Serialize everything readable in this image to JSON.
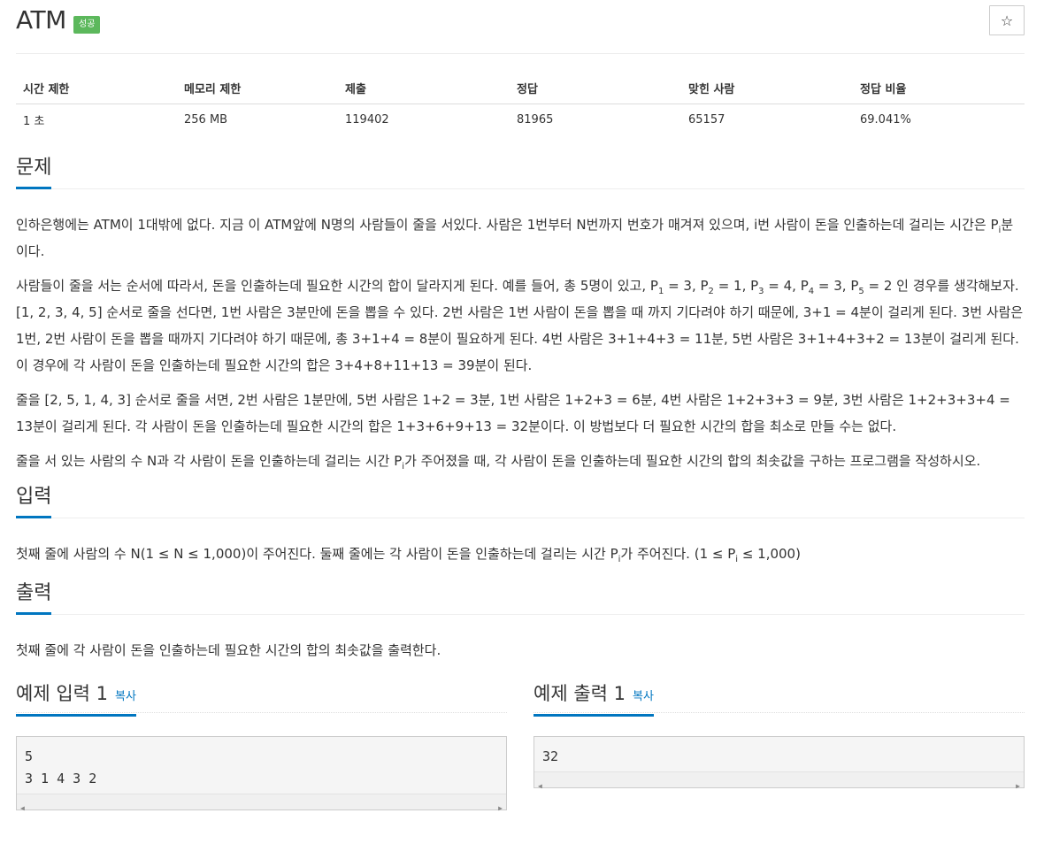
{
  "problem": {
    "title": "ATM",
    "badge": "성공",
    "star": "☆"
  },
  "info": {
    "headers": [
      "시간 제한",
      "메모리 제한",
      "제출",
      "정답",
      "맞힌 사람",
      "정답 비율"
    ],
    "values": [
      "1 초",
      "256 MB",
      "119402",
      "81965",
      "65157",
      "69.041%"
    ]
  },
  "sections": {
    "problem": "문제",
    "input": "입력",
    "output": "출력"
  },
  "text": {
    "p1a": "인하은행에는 ATM이 1대밖에 없다. 지금 이 ATM앞에 N명의 사람들이 줄을 서있다. 사람은 1번부터 N번까지 번호가 매겨져 있으며, i번 사람이 돈을 인출하는데 걸리는 시간은 P",
    "p1sub": "i",
    "p1b": "분이다.",
    "p2a": "사람들이 줄을 서는 순서에 따라서, 돈을 인출하는데 필요한 시간의 합이 달라지게 된다. 예를 들어, 총 5명이 있고, P",
    "p2s1": "1",
    "p2t1": " = 3, P",
    "p2s2": "2",
    "p2t2": " = 1, P",
    "p2s3": "3",
    "p2t3": " = 4, P",
    "p2s4": "4",
    "p2t4": " = 3, P",
    "p2s5": "5",
    "p2b": " = 2 인 경우를 생각해보자. [1, 2, 3, 4, 5] 순서로 줄을 선다면, 1번 사람은 3분만에 돈을 뽑을 수 있다. 2번 사람은 1번 사람이 돈을 뽑을 때 까지 기다려야 하기 때문에, 3+1 = 4분이 걸리게 된다. 3번 사람은 1번, 2번 사람이 돈을 뽑을 때까지 기다려야 하기 때문에, 총 3+1+4 = 8분이 필요하게 된다. 4번 사람은 3+1+4+3 = 11분, 5번 사람은 3+1+4+3+2 = 13분이 걸리게 된다. 이 경우에 각 사람이 돈을 인출하는데 필요한 시간의 합은 3+4+8+11+13 = 39분이 된다.",
    "p3": "줄을 [2, 5, 1, 4, 3] 순서로 줄을 서면, 2번 사람은 1분만에, 5번 사람은 1+2 = 3분, 1번 사람은 1+2+3 = 6분, 4번 사람은 1+2+3+3 = 9분, 3번 사람은 1+2+3+3+4 = 13분이 걸리게 된다. 각 사람이 돈을 인출하는데 필요한 시간의 합은 1+3+6+9+13 = 32분이다. 이 방법보다 더 필요한 시간의 합을 최소로 만들 수는 없다.",
    "p4a": "줄을 서 있는 사람의 수 N과 각 사람이 돈을 인출하는데 걸리는 시간 P",
    "p4sub": "i",
    "p4b": "가 주어졌을 때, 각 사람이 돈을 인출하는데 필요한 시간의 합의 최솟값을 구하는 프로그램을 작성하시오.",
    "in_a": "첫째 줄에 사람의 수 N(1 ≤ N ≤ 1,000)이 주어진다. 둘째 줄에는 각 사람이 돈을 인출하는데 걸리는 시간 P",
    "in_sub1": "i",
    "in_b": "가 주어진다. (1 ≤ P",
    "in_sub2": "i",
    "in_c": " ≤ 1,000)",
    "out": "첫째 줄에 각 사람이 돈을 인출하는데 필요한 시간의 합의 최솟값을 출력한다."
  },
  "samples": {
    "input_title": "예제 입력 1",
    "output_title": "예제 출력 1",
    "copy": "복사",
    "input_lines": [
      "5",
      "3 1 4 3 2"
    ],
    "output_lines": [
      "32"
    ]
  },
  "colors": {
    "accent": "#0076c0",
    "badge": "#5cb85c"
  }
}
